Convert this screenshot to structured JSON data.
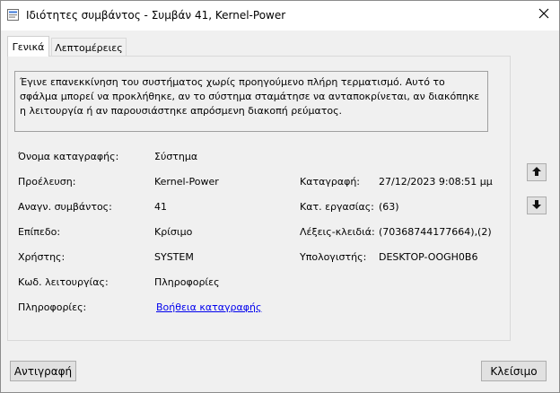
{
  "window": {
    "title": "Ιδιότητες συμβάντος - Συμβάν 41, Kernel-Power"
  },
  "tabs": [
    {
      "label": "Γενικά",
      "active": true
    },
    {
      "label": "Λεπτομέρειες",
      "active": false
    }
  ],
  "description": "Έγινε επανεκκίνηση του συστήματος χωρίς προηγούμενο πλήρη τερματισμό. Αυτό το σφάλμα μπορεί να προκλήθηκε, αν το σύστημα σταμάτησε να ανταποκρίνεται, αν διακόπηκε η λειτουργία ή αν παρουσιάστηκε απρόσμενη διακοπή ρεύματος.",
  "fields": {
    "log_name": {
      "label": "Όνομα καταγραφής:",
      "value": "Σύστημα"
    },
    "source": {
      "label": "Προέλευση:",
      "value": "Kernel-Power"
    },
    "event_id": {
      "label": "Αναγν. συμβάντος:",
      "value": "41"
    },
    "level": {
      "label": "Επίπεδο:",
      "value": "Κρίσιμο"
    },
    "user": {
      "label": "Χρήστης:",
      "value": "SYSTEM"
    },
    "opcode": {
      "label": "Κωδ. λειτουργίας:",
      "value": "Πληροφορίες"
    },
    "more_info": {
      "label": "Πληροφορίες:",
      "value": "Βοήθεια καταγραφής"
    },
    "logged": {
      "label": "Καταγραφή:",
      "value": "27/12/2023 9:08:51 μμ"
    },
    "task_category": {
      "label": "Κατ. εργασίας:",
      "value": "(63)"
    },
    "keywords": {
      "label": "Λέξεις-κλειδιά:",
      "value": "(70368744177664),(2)"
    },
    "computer": {
      "label": "Υπολογιστής:",
      "value": "DESKTOP-OOGH0B6"
    }
  },
  "buttons": {
    "copy": "Αντιγραφή",
    "close": "Κλείσιμο"
  },
  "icons": {
    "app": "event-viewer-icon",
    "close": "close-icon",
    "up": "arrow-up-icon",
    "down": "arrow-down-icon"
  }
}
